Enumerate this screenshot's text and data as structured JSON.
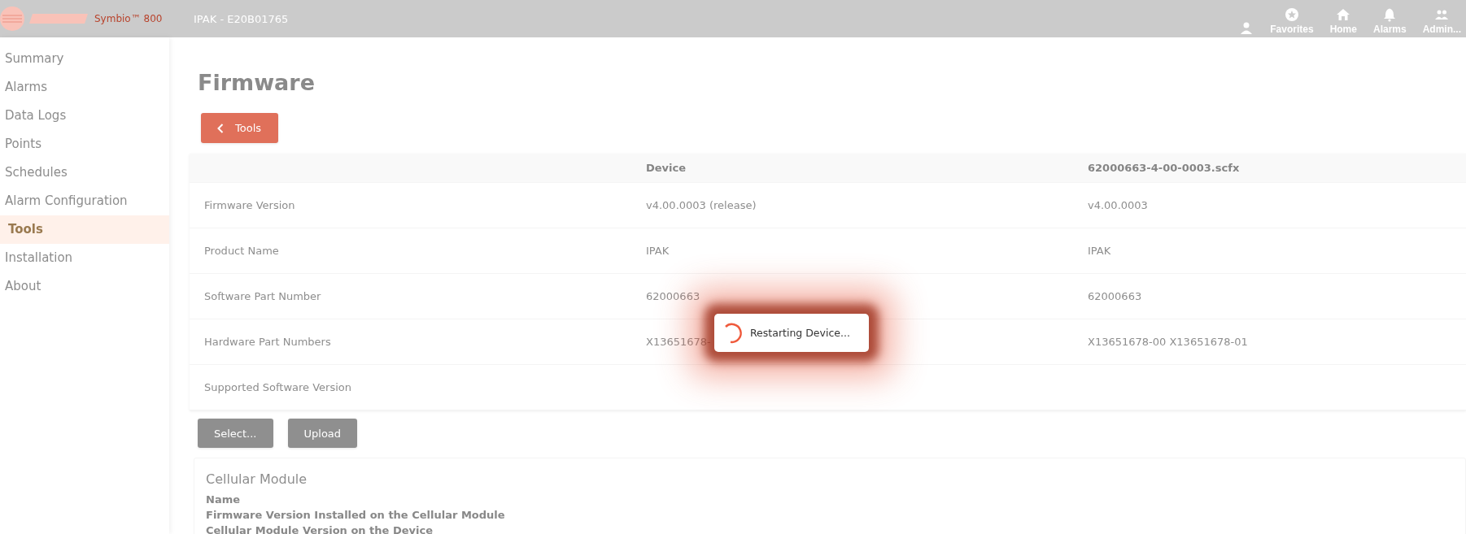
{
  "header": {
    "brand": "Symbio™ 800",
    "device": "IPAK - E20B01765",
    "nav": [
      {
        "kind": "user"
      },
      {
        "kind": "star",
        "label": "Favorites"
      },
      {
        "kind": "home",
        "label": "Home"
      },
      {
        "kind": "bell",
        "label": "Alarms"
      },
      {
        "kind": "people",
        "label": "Admin..."
      }
    ]
  },
  "sidebar": {
    "items": [
      {
        "label": "Summary",
        "selected": false
      },
      {
        "label": "Alarms",
        "selected": false
      },
      {
        "label": "Data Logs",
        "selected": false
      },
      {
        "label": "Points",
        "selected": false
      },
      {
        "label": "Schedules",
        "selected": false
      },
      {
        "label": "Alarm Configuration",
        "selected": false
      },
      {
        "label": "Tools",
        "selected": true
      },
      {
        "label": "Installation",
        "selected": false
      },
      {
        "label": "About",
        "selected": false
      }
    ]
  },
  "page_title": "Firmware",
  "back_button": "Tools",
  "table": {
    "columns": [
      "",
      "Device",
      "62000663-4-00-0003.scfx"
    ],
    "rows": [
      [
        "Firmware Version",
        "v4.00.0003 (release)",
        "v4.00.0003"
      ],
      [
        "Product Name",
        "IPAK",
        "IPAK"
      ],
      [
        "Software Part Number",
        "62000663",
        "62000663"
      ],
      [
        "Hardware Part Numbers",
        "X13651678-",
        "X13651678-00 X13651678-01"
      ],
      [
        "Supported Software Version",
        "",
        ""
      ]
    ]
  },
  "buttons": [
    "Select...",
    "Upload"
  ],
  "cellular": {
    "title": "Cellular Module",
    "fields": [
      "Name",
      "Firmware Version Installed on the Cellular Module",
      "Cellular Module Version on the Device"
    ]
  },
  "dialog": {
    "message": "Restarting Device..."
  }
}
